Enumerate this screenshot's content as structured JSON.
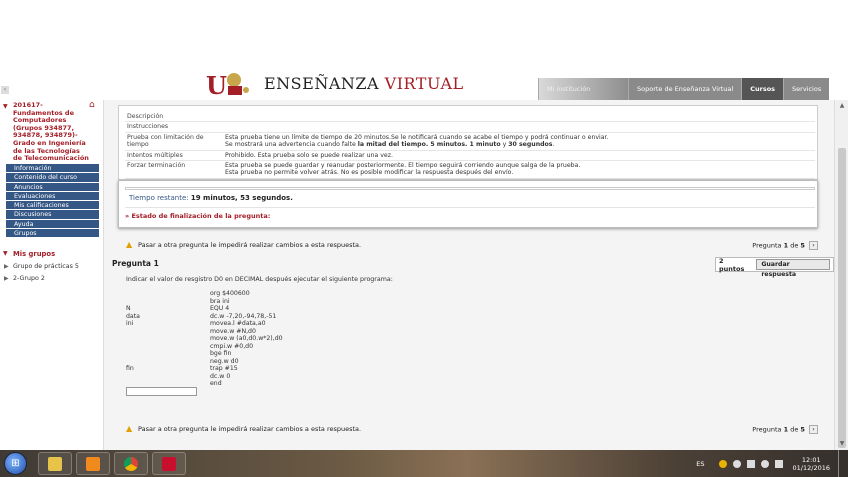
{
  "header": {
    "logo_text_a": "ENSEÑANZA",
    "logo_text_b": "VIRTUAL",
    "nav": [
      "Mi institución",
      "Soporte de Enseñanza Virtual",
      "Cursos",
      "Servicios"
    ],
    "active_nav": "Cursos"
  },
  "sidebar": {
    "course_title": "201617-Fundamentos de Computadores (Grupos 934877, 934878, 934879)-Grado en Ingeniería de las Tecnologías de Telecomunicación",
    "menu": [
      "Información",
      "Contenido del curso",
      "Anuncios",
      "Evaluaciones",
      "Mis calificaciones",
      "Discusiones",
      "Ayuda",
      "Grupos"
    ],
    "groups_heading": "Mis grupos",
    "groups": [
      "Grupo de prácticas 5",
      "2-Grupo 2"
    ]
  },
  "info": {
    "rows": [
      {
        "k": "Descripción",
        "v": ""
      },
      {
        "k": "Instrucciones",
        "v": ""
      },
      {
        "k": "Prueba con limitación de tiempo",
        "v": "Esta prueba tiene un límite de tiempo de 20 minutos.Se le notificará cuando se acabe el tiempo y podrá continuar o enviar.",
        "v2a": "Se mostrará una advertencia cuando falte ",
        "v2b": "la mitad del tiempo. 5 minutos. 1 minuto",
        "v2c": " y ",
        "v2d": "30 segundos",
        "v2e": "."
      },
      {
        "k": "Intentos múltiples",
        "v": "Prohibido. Esta prueba solo se puede realizar una vez."
      },
      {
        "k": "Forzar terminación",
        "v": "Esta prueba se puede guardar y reanudar posteriormente. El tiempo seguirá corriendo aunque salga de la prueba.",
        "v2": "Esta prueba se puede guardar y reanudar posteriormente. El tiempo seguirá corriendo aunque salga de la prueba."
      }
    ],
    "extra_line": "Esta prueba no permite volver atrás. No es posible modificar la respuesta después del envío."
  },
  "timer": {
    "label": "Tiempo restante:",
    "value": "19 minutos, 53 segundos.",
    "status_link": "Estado de finalización de la pregunta:"
  },
  "warning": {
    "text": "Pasar a otra pregunta le impedirá realizar cambios a esta respuesta.",
    "page_prefix": "Pregunta",
    "page_current": "1",
    "page_of": "de",
    "page_total": "5"
  },
  "question": {
    "title": "Pregunta 1",
    "points": "2 puntos",
    "save_label": "Guardar respuesta",
    "text": "Indicar el valor de resgistro D0 en DECIMAL después ejecutar el siguiente programa:",
    "code": [
      {
        "label": "",
        "instr": "org $400600"
      },
      {
        "label": "",
        "instr": "bra ini"
      },
      {
        "label": "N",
        "instr": "EQU 4"
      },
      {
        "label": "data",
        "instr": "dc.w -7,20,-94,78,-51"
      },
      {
        "label": "ini",
        "instr": "movea.l #data,a0"
      },
      {
        "label": "",
        "instr": "move.w #N,d0"
      },
      {
        "label": "",
        "instr": "move.w (a0,d0.w*2),d0"
      },
      {
        "label": "",
        "instr": "cmpi.w #0,d0"
      },
      {
        "label": "",
        "instr": "bge fin"
      },
      {
        "label": "",
        "instr": "neg.w d0"
      },
      {
        "label": "fin",
        "instr": "trap #15"
      },
      {
        "label": "",
        "instr": "dc.w 0"
      },
      {
        "label": "",
        "instr": "end"
      }
    ],
    "answer_value": ""
  },
  "taskbar": {
    "lang": "ES",
    "time": "12:01",
    "date": "01/12/2016"
  },
  "colors": {
    "brand_red": "#a41e27",
    "menu_blue": "#355785",
    "nav_gray": "#8a8a8a",
    "nav_active": "#555555"
  }
}
